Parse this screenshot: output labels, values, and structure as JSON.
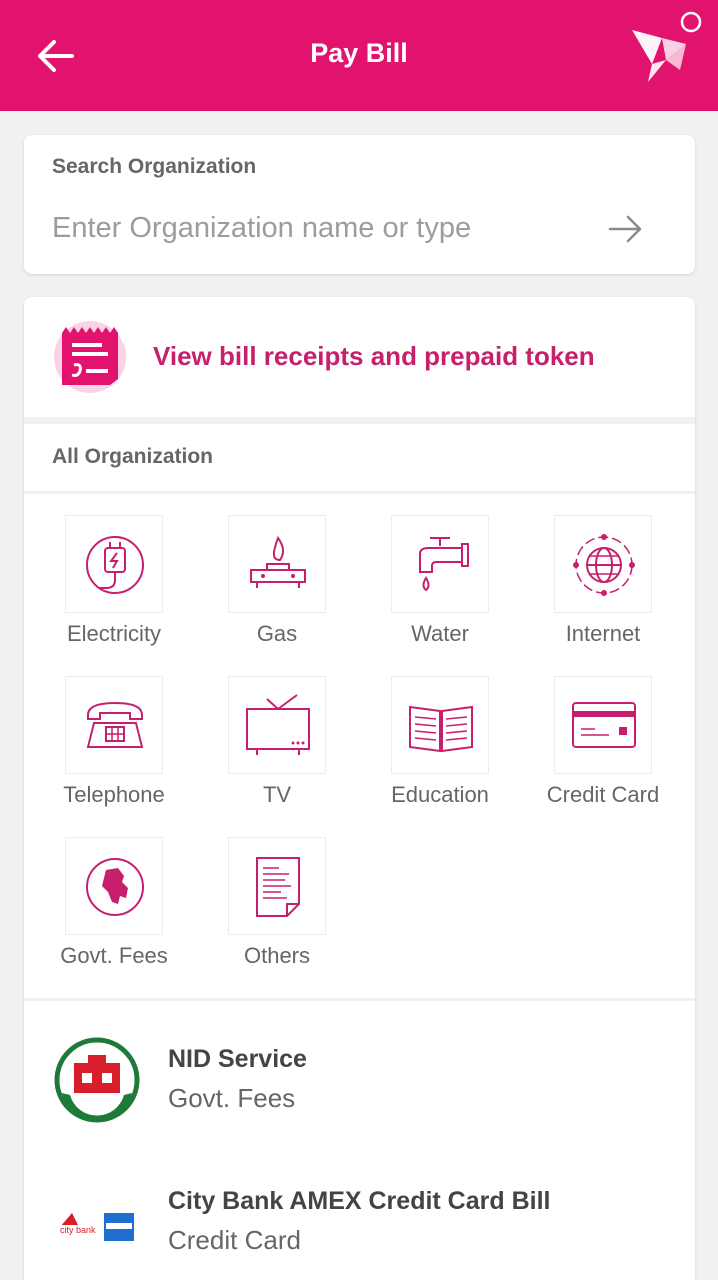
{
  "header": {
    "title": "Pay Bill"
  },
  "search": {
    "label": "Search Organization",
    "placeholder": "Enter Organization name or type"
  },
  "receipts": {
    "label": "View bill receipts and prepaid token"
  },
  "all_org": {
    "title": "All Organization",
    "items": [
      {
        "label": "Electricity",
        "icon": "electricity-icon"
      },
      {
        "label": "Gas",
        "icon": "gas-icon"
      },
      {
        "label": "Water",
        "icon": "water-icon"
      },
      {
        "label": "Internet",
        "icon": "internet-icon"
      },
      {
        "label": "Telephone",
        "icon": "telephone-icon"
      },
      {
        "label": "TV",
        "icon": "tv-icon"
      },
      {
        "label": "Education",
        "icon": "education-icon"
      },
      {
        "label": "Credit Card",
        "icon": "credit-card-icon"
      },
      {
        "label": "Govt. Fees",
        "icon": "govt-fees-icon"
      },
      {
        "label": "Others",
        "icon": "others-icon"
      }
    ]
  },
  "organizations": [
    {
      "name": "NID Service",
      "category": "Govt. Fees"
    },
    {
      "name": "City Bank AMEX Credit Card Bill",
      "category": "Credit Card"
    }
  ],
  "colors": {
    "brand": "#e2136e",
    "accent_text": "#c71f6e"
  }
}
